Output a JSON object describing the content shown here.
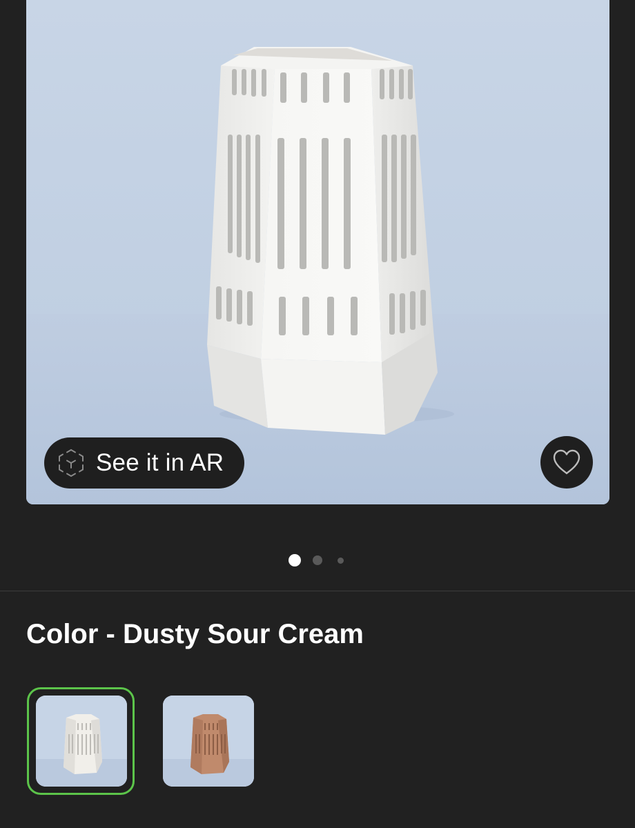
{
  "hero": {
    "ar_button": {
      "label": "See it in AR",
      "icon": "ar-cube-icon"
    },
    "favorite_button": {
      "icon": "heart-outline-icon"
    }
  },
  "carousel": {
    "page_count": 3,
    "active_index": 0
  },
  "variant": {
    "color_label": "Color - Dusty Sour Cream",
    "swatches": [
      {
        "name": "Dusty Sour Cream",
        "selected": true,
        "color": "#f1efea"
      },
      {
        "name": "Terracotta",
        "selected": false,
        "color": "#c08a6c"
      }
    ]
  },
  "colors": {
    "background": "#212121",
    "selection_ring": "#5cc44a",
    "wall": "#c9d6e6"
  }
}
